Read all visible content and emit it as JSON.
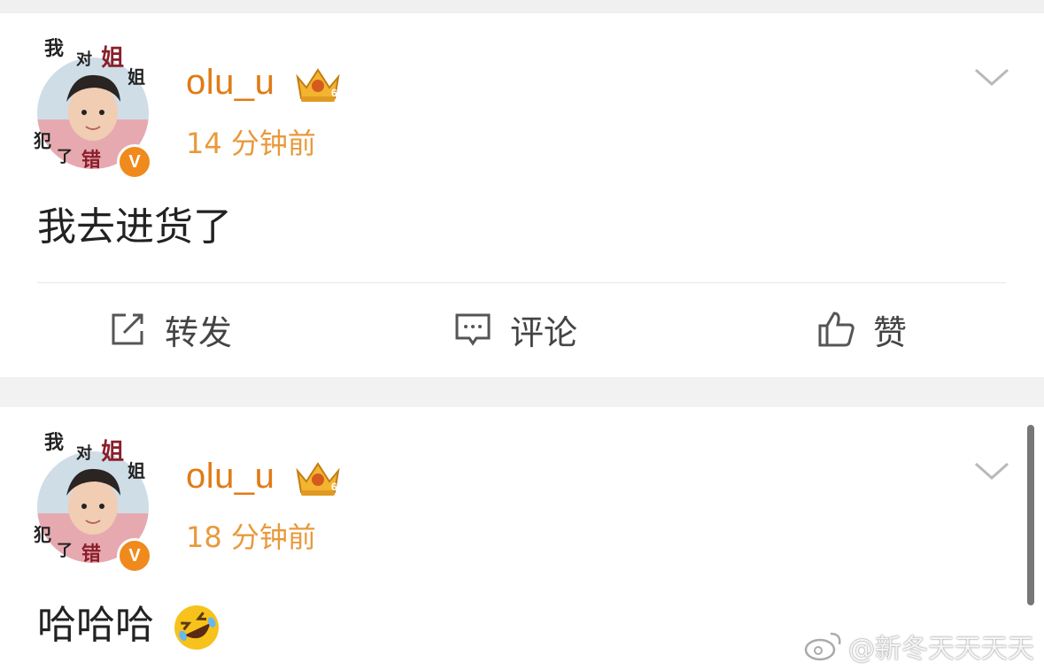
{
  "posts": [
    {
      "username": "olu_u",
      "time": "14 分钟前",
      "content": "我去进货了",
      "avatar_stickers": [
        "我",
        "对",
        "姐",
        "姐",
        "犯",
        "了",
        "错"
      ],
      "verified_badge": "V"
    },
    {
      "username": "olu_u",
      "time": "18 分钟前",
      "content": "哈哈哈",
      "content_emoji": "rolling-on-floor-laughing",
      "avatar_stickers": [
        "我",
        "对",
        "姐",
        "姐",
        "犯",
        "了",
        "错"
      ],
      "verified_badge": "V"
    }
  ],
  "actions": {
    "repost": "转发",
    "comment": "评论",
    "like": "赞"
  },
  "watermark": "@新冬天天天天",
  "colors": {
    "username": "#e07b16",
    "time": "#e89a3c",
    "badge": "#f08a1c"
  },
  "icons": [
    "crown-badge-icon",
    "chevron-down-icon",
    "repost-icon",
    "comment-icon",
    "like-icon",
    "weibo-logo-icon"
  ]
}
